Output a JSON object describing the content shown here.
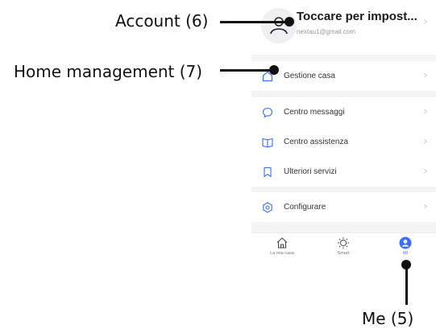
{
  "account": {
    "name": "Toccare per impost...",
    "email": "nextau1@gmail.com"
  },
  "menu": {
    "home_management": "Gestione casa",
    "message_center": "Centro messaggi",
    "help_center": "Centro assistenza",
    "more_services": "Ulteriori servizi",
    "settings": "Configurare"
  },
  "tabs": [
    {
      "label": "La mia casa",
      "icon": "home-icon"
    },
    {
      "label": "Smart",
      "icon": "smart-sun-icon"
    },
    {
      "label": "Mi",
      "icon": "profile-icon"
    }
  ],
  "annotations": {
    "account": "Account (6)",
    "home_management": "Home management (7)",
    "me": "Me (5)"
  },
  "colors": {
    "accent": "#3a6ff0",
    "background": "#f4f4f5",
    "annotation": "#111111"
  }
}
